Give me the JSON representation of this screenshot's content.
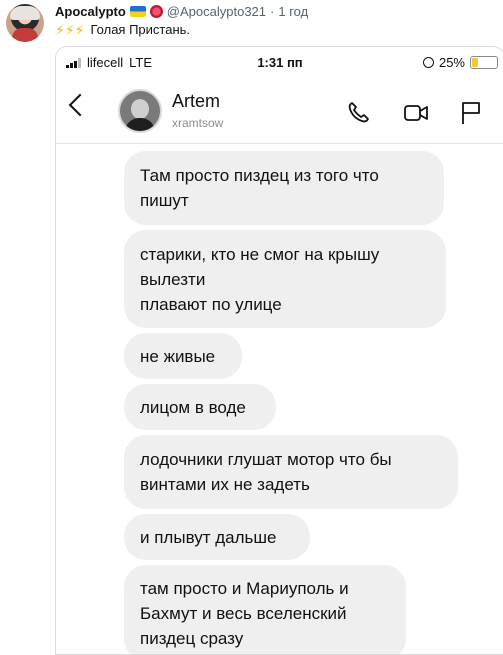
{
  "tweet": {
    "author_name": "Apocalypto",
    "handle": "@Apocalypto321",
    "separator": "·",
    "time": "1 год",
    "bolts": "⚡⚡⚡",
    "text": "Голая Пристань."
  },
  "phone": {
    "status_bar": {
      "carrier": "lifecell",
      "network": "LTE",
      "time": "1:31 пп",
      "battery": "25%",
      "battery_level": 0.25
    },
    "chat_header": {
      "contact_name": "Artem",
      "contact_username": "xramtsow",
      "icons": [
        "back-chevron-icon",
        "phone-icon",
        "video-camera-icon",
        "flag-icon"
      ]
    },
    "messages": [
      {
        "lines": [
          "Там просто пиздец из того что",
          "пишут"
        ]
      },
      {
        "lines": [
          "старики, кто не смог на крышу",
          "вылезти",
          "плавают по улице"
        ]
      },
      {
        "lines": [
          "не живые"
        ]
      },
      {
        "lines": [
          "лицом в воде"
        ]
      },
      {
        "lines": [
          "лодочники глушат мотор что бы",
          "винтами их не задеть"
        ]
      },
      {
        "lines": [
          "и плывут дальше"
        ]
      },
      {
        "lines": [
          "там просто и Мариуполь и",
          "Бахмут и весь вселенский",
          "пиздец сразу"
        ]
      }
    ]
  },
  "colors": {
    "bubble": "#efefef",
    "handle_gray": "#536471",
    "battery_fill": "#f0c93a"
  }
}
